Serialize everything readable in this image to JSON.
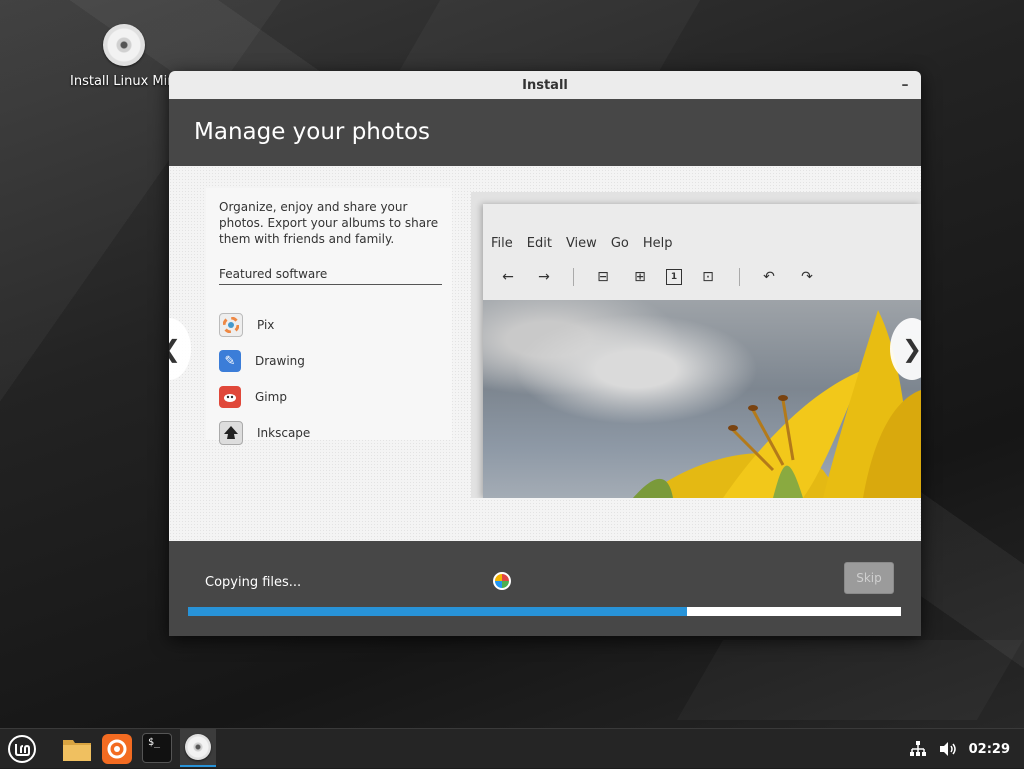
{
  "desktop": {
    "icons": [
      {
        "label": "Install Linux Mint",
        "icon": "disc-icon"
      }
    ]
  },
  "window": {
    "title": "Install",
    "minimize_symbol": "–"
  },
  "slide": {
    "title": "Manage your photos",
    "description": "Organize, enjoy and share your photos. Export your albums to share them with friends and family.",
    "featured_label": "Featured software",
    "apps": [
      {
        "name": "Pix",
        "icon": "pix-icon"
      },
      {
        "name": "Drawing",
        "icon": "drawing-icon"
      },
      {
        "name": "Gimp",
        "icon": "gimp-icon"
      },
      {
        "name": "Inkscape",
        "icon": "inkscape-icon"
      }
    ],
    "prev_symbol": "❮",
    "next_symbol": "❯",
    "preview_menu": [
      "File",
      "Edit",
      "View",
      "Go",
      "Help"
    ],
    "preview_toolbar": [
      "←",
      "→",
      "⊟",
      "⊞",
      "1",
      "⊡",
      "↶",
      "↷"
    ]
  },
  "progress": {
    "status": "Copying files...",
    "fraction": 0.7,
    "skip_label": "Skip"
  },
  "taskbar": {
    "apps": [
      "menu-icon",
      "files-icon",
      "firefox-icon",
      "terminal-icon",
      "installer-icon"
    ],
    "terminal_glyph": "$_",
    "tray": [
      "network-icon",
      "volume-icon"
    ],
    "clock": "02:29"
  },
  "colors": {
    "accent": "#2893d8",
    "header": "#474747",
    "titlebar": "#ececec"
  }
}
